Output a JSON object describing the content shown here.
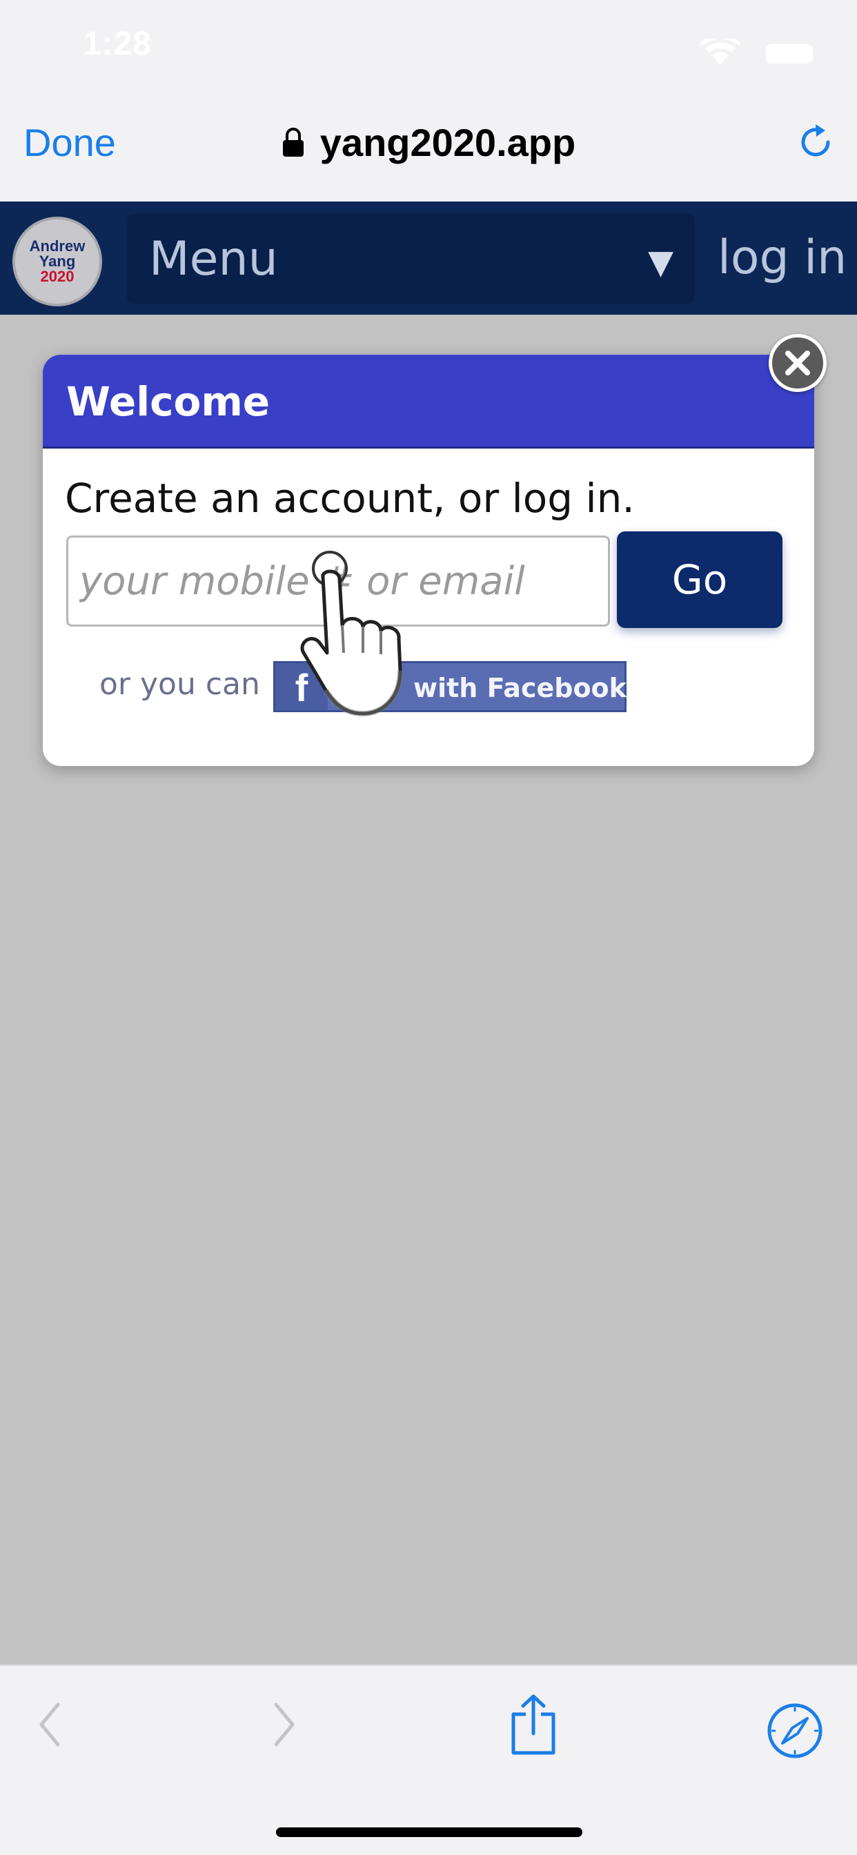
{
  "status_bar": {
    "time": "1:28"
  },
  "browser": {
    "done_label": "Done",
    "url": "yang2020.app"
  },
  "site": {
    "logo": {
      "line1": "Andrew",
      "line2": "Yang",
      "line3": "2020"
    },
    "menu_label": "Menu",
    "menu_arrow": "▼",
    "login_label": "log in"
  },
  "modal": {
    "title": "Welcome",
    "prompt": "Create an account, or log in.",
    "input_placeholder": "your mobile # or email",
    "go_label": "Go",
    "or_text": "or you can",
    "facebook_label": "with Facebook",
    "facebook_glyph": "f"
  },
  "colors": {
    "safari_blue": "#1a7ee8",
    "site_nav": "#0c2656",
    "modal_header": "#3a3fc8",
    "go_button": "#0d2a6b",
    "facebook": "#5a6db3",
    "overlay": "#c2c2c2"
  },
  "icons": {
    "status": [
      "wifi-icon",
      "battery-icon"
    ],
    "top": [
      "lock-icon",
      "reload-icon"
    ],
    "bottom": [
      "back-icon",
      "forward-icon",
      "share-icon",
      "compass-icon"
    ],
    "modal": [
      "close-icon",
      "hand-pointer-icon"
    ]
  }
}
